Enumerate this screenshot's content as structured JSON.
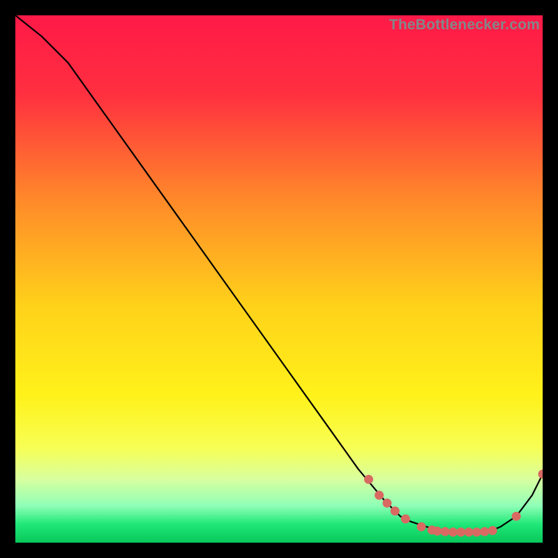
{
  "watermark": "TheBottlenecker.com",
  "chart_data": {
    "type": "line",
    "title": "",
    "xlabel": "",
    "ylabel": "",
    "xlim": [
      0,
      100
    ],
    "ylim": [
      0,
      100
    ],
    "x": [
      0,
      5,
      10,
      15,
      20,
      25,
      30,
      35,
      40,
      45,
      50,
      55,
      60,
      65,
      70,
      73,
      75,
      78,
      80,
      82,
      84,
      86,
      88,
      90,
      92,
      95,
      98,
      100
    ],
    "values": [
      100,
      96,
      91,
      84,
      77,
      70,
      63,
      56,
      49,
      42,
      35,
      28,
      21,
      14,
      8,
      5,
      4,
      3,
      2.5,
      2.2,
      2,
      2,
      2,
      2.2,
      3,
      5,
      9,
      13
    ],
    "points": [
      {
        "x": 67,
        "y": 12
      },
      {
        "x": 69,
        "y": 9
      },
      {
        "x": 70.5,
        "y": 7.5
      },
      {
        "x": 72,
        "y": 6
      },
      {
        "x": 74,
        "y": 4.5
      },
      {
        "x": 77,
        "y": 3
      },
      {
        "x": 79,
        "y": 2.4
      },
      {
        "x": 80,
        "y": 2.2
      },
      {
        "x": 81.5,
        "y": 2.1
      },
      {
        "x": 83,
        "y": 2
      },
      {
        "x": 84.5,
        "y": 2
      },
      {
        "x": 86,
        "y": 2
      },
      {
        "x": 87.5,
        "y": 2
      },
      {
        "x": 89,
        "y": 2.1
      },
      {
        "x": 90.5,
        "y": 2.3
      },
      {
        "x": 95,
        "y": 5
      },
      {
        "x": 100,
        "y": 13
      }
    ],
    "gradient_stops": [
      {
        "pos": 0.0,
        "color": "#ff1a48"
      },
      {
        "pos": 0.15,
        "color": "#ff3040"
      },
      {
        "pos": 0.35,
        "color": "#ff8a2a"
      },
      {
        "pos": 0.55,
        "color": "#ffd21a"
      },
      {
        "pos": 0.72,
        "color": "#fff21a"
      },
      {
        "pos": 0.82,
        "color": "#f8ff55"
      },
      {
        "pos": 0.88,
        "color": "#d8ffa0"
      },
      {
        "pos": 0.93,
        "color": "#90ffb8"
      },
      {
        "pos": 0.965,
        "color": "#20e878"
      },
      {
        "pos": 1.0,
        "color": "#08c85a"
      }
    ],
    "point_color": "#d86a62",
    "curve_color": "#000000"
  }
}
